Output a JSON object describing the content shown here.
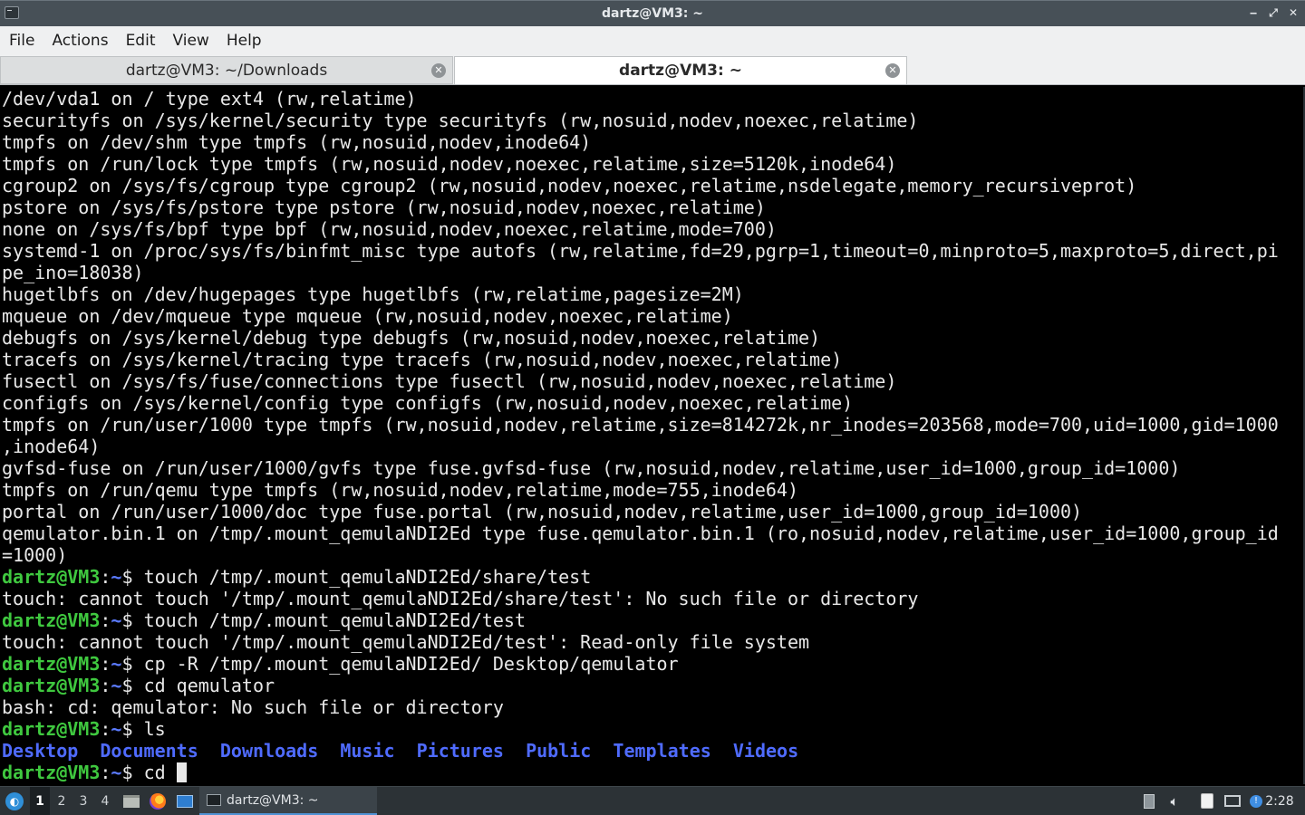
{
  "window": {
    "title": "dartz@VM3: ~",
    "minimize_glyph": "‒",
    "maximize_glyph": "⤢",
    "close_glyph": "✕"
  },
  "menu": [
    "File",
    "Actions",
    "Edit",
    "View",
    "Help"
  ],
  "tabs": [
    {
      "label": "dartz@VM3: ~/Downloads",
      "active": false
    },
    {
      "label": "dartz@VM3: ~",
      "active": true
    }
  ],
  "terminal": {
    "prompt_user": "dartz@VM3",
    "prompt_sep": ":",
    "prompt_path": "~",
    "prompt_dollar": "$ ",
    "output_lines": [
      "/dev/vda1 on / type ext4 (rw,relatime)",
      "securityfs on /sys/kernel/security type securityfs (rw,nosuid,nodev,noexec,relatime)",
      "tmpfs on /dev/shm type tmpfs (rw,nosuid,nodev,inode64)",
      "tmpfs on /run/lock type tmpfs (rw,nosuid,nodev,noexec,relatime,size=5120k,inode64)",
      "cgroup2 on /sys/fs/cgroup type cgroup2 (rw,nosuid,nodev,noexec,relatime,nsdelegate,memory_recursiveprot)",
      "pstore on /sys/fs/pstore type pstore (rw,nosuid,nodev,noexec,relatime)",
      "none on /sys/fs/bpf type bpf (rw,nosuid,nodev,noexec,relatime,mode=700)",
      "systemd-1 on /proc/sys/fs/binfmt_misc type autofs (rw,relatime,fd=29,pgrp=1,timeout=0,minproto=5,maxproto=5,direct,pi",
      "pe_ino=18038)",
      "hugetlbfs on /dev/hugepages type hugetlbfs (rw,relatime,pagesize=2M)",
      "mqueue on /dev/mqueue type mqueue (rw,nosuid,nodev,noexec,relatime)",
      "debugfs on /sys/kernel/debug type debugfs (rw,nosuid,nodev,noexec,relatime)",
      "tracefs on /sys/kernel/tracing type tracefs (rw,nosuid,nodev,noexec,relatime)",
      "fusectl on /sys/fs/fuse/connections type fusectl (rw,nosuid,nodev,noexec,relatime)",
      "configfs on /sys/kernel/config type configfs (rw,nosuid,nodev,noexec,relatime)",
      "tmpfs on /run/user/1000 type tmpfs (rw,nosuid,nodev,relatime,size=814272k,nr_inodes=203568,mode=700,uid=1000,gid=1000",
      ",inode64)",
      "gvfsd-fuse on /run/user/1000/gvfs type fuse.gvfsd-fuse (rw,nosuid,nodev,relatime,user_id=1000,group_id=1000)",
      "tmpfs on /run/qemu type tmpfs (rw,nosuid,nodev,relatime,mode=755,inode64)",
      "portal on /run/user/1000/doc type fuse.portal (rw,nosuid,nodev,relatime,user_id=1000,group_id=1000)",
      "qemulator.bin.1 on /tmp/.mount_qemulaNDI2Ed type fuse.qemulator.bin.1 (ro,nosuid,nodev,relatime,user_id=1000,group_id",
      "=1000)"
    ],
    "session": [
      {
        "command": "touch /tmp/.mount_qemulaNDI2Ed/share/test"
      },
      {
        "output": "touch: cannot touch '/tmp/.mount_qemulaNDI2Ed/share/test': No such file or directory"
      },
      {
        "command": "touch /tmp/.mount_qemulaNDI2Ed/test"
      },
      {
        "output": "touch: cannot touch '/tmp/.mount_qemulaNDI2Ed/test': Read-only file system"
      },
      {
        "command": "cp -R /tmp/.mount_qemulaNDI2Ed/ Desktop/qemulator"
      },
      {
        "command": "cd qemulator"
      },
      {
        "output": "bash: cd: qemulator: No such file or directory"
      },
      {
        "command": "ls"
      }
    ],
    "ls_items": [
      "Desktop",
      "Documents",
      "Downloads",
      "Music",
      "Pictures",
      "Public",
      "Templates",
      "Videos"
    ],
    "current_input": "cd "
  },
  "taskbar": {
    "menu_icon": "lxqt-menu-icon",
    "workspaces": [
      "1",
      "2",
      "3",
      "4"
    ],
    "current_workspace": "1",
    "quick_launch": [
      "file-manager-icon",
      "firefox-icon",
      "show-desktop-icon"
    ],
    "task_label": "dartz@VM3: ~",
    "tray": [
      "battery-icon",
      "volume-icon",
      "clipboard-icon",
      "network-icon",
      "update-notifier-icon"
    ],
    "clock": "2:28"
  }
}
